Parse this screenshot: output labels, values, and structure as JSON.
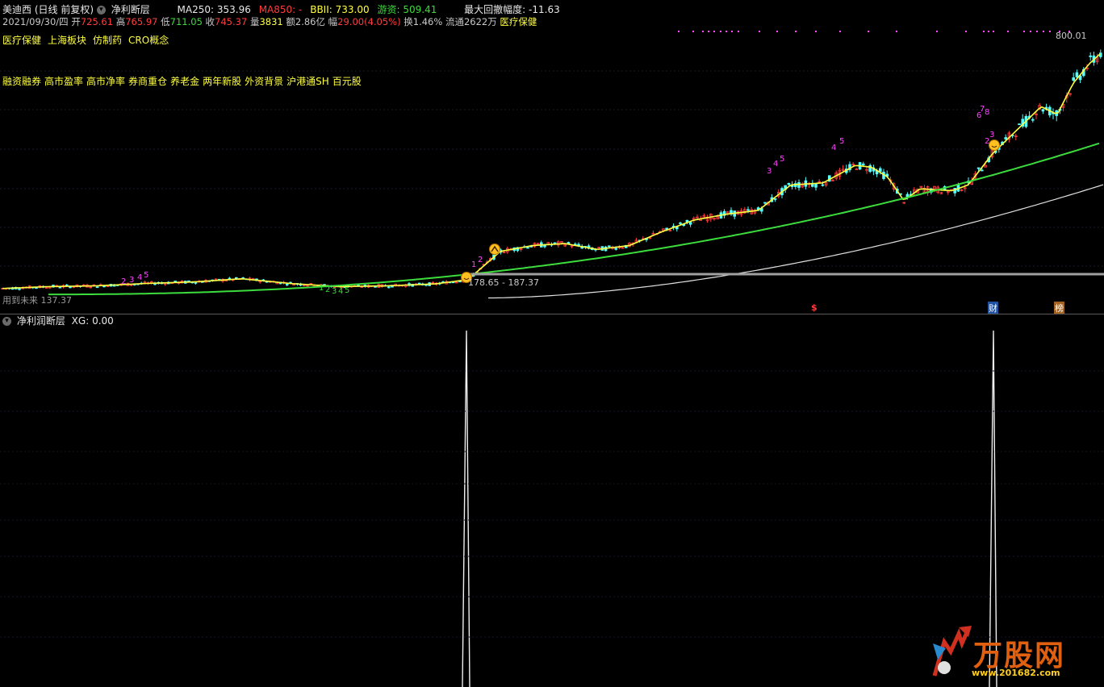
{
  "header": {
    "stock_name": "美迪西",
    "period": "(日线 前复权)",
    "indicator": "净利断层",
    "ma250_label": "MA250:",
    "ma250_value": "353.96",
    "ma850_label": "MA850:",
    "ma850_value": "-",
    "bbii_label": "BBII:",
    "bbii_value": "733.00",
    "youzi_label": "游资:",
    "youzi_value": "509.41",
    "drawdown_label": "最大回撤幅度:",
    "drawdown_value": "-11.63"
  },
  "quote": {
    "date": "2021/09/30/四",
    "open_label": "开",
    "open": "725.61",
    "high_label": "高",
    "high": "765.97",
    "low_label": "低",
    "low": "711.05",
    "close_label": "收",
    "close": "745.37",
    "vol_label": "量",
    "vol": "3831",
    "amount_label": "额",
    "amount": "2.86亿",
    "change_label": "幅",
    "change": "29.00(4.05%)",
    "turnover_label": "换",
    "turnover": "1.46%",
    "float_label": "流通",
    "float": "2622万",
    "sector": "医疗保健"
  },
  "tags_line1": [
    "医疗保健",
    "上海板块",
    "仿制药",
    "CRO概念"
  ],
  "tags_line2": [
    "融资融券",
    "高市盈率",
    "高市净率",
    "券商重仓",
    "养老金",
    "两年新股",
    "外资背景",
    "沪港通SH",
    "百元股"
  ],
  "price_labels": {
    "max_label": "800.01",
    "min_label": "178.65 - 187.37",
    "bottom_left": "用到未来  137.37"
  },
  "event_markers": [
    "$",
    "财",
    "榜"
  ],
  "subchart": {
    "title": "净利润断层",
    "xg_label": "XG:",
    "xg_value": "0.00"
  },
  "watermark": {
    "brand": "万股网",
    "url": "www.201682.com"
  },
  "colors": {
    "up": "#ff3c3c",
    "down": "#54ffff",
    "ma_yellow": "#ffff40",
    "ma_green": "#3cdc3c",
    "ma_white": "#e0e0e0",
    "magenta": "#ff40ff"
  },
  "chart_data": {
    "type": "line",
    "ylim": [
      130,
      810
    ],
    "trend_points": [
      [
        0,
        155
      ],
      [
        60,
        160
      ],
      [
        120,
        162
      ],
      [
        180,
        168
      ],
      [
        240,
        172
      ],
      [
        300,
        180
      ],
      [
        360,
        168
      ],
      [
        420,
        160
      ],
      [
        480,
        162
      ],
      [
        540,
        167
      ],
      [
        580,
        178
      ],
      [
        620,
        250
      ],
      [
        660,
        265
      ],
      [
        700,
        270
      ],
      [
        740,
        255
      ],
      [
        780,
        265
      ],
      [
        820,
        300
      ],
      [
        860,
        330
      ],
      [
        900,
        345
      ],
      [
        940,
        355
      ],
      [
        980,
        420
      ],
      [
        1020,
        425
      ],
      [
        1060,
        470
      ],
      [
        1080,
        465
      ],
      [
        1100,
        440
      ],
      [
        1120,
        380
      ],
      [
        1140,
        410
      ],
      [
        1180,
        405
      ],
      [
        1200,
        420
      ],
      [
        1230,
        500
      ],
      [
        1260,
        560
      ],
      [
        1290,
        620
      ],
      [
        1310,
        600
      ],
      [
        1330,
        680
      ],
      [
        1350,
        730
      ],
      [
        1366,
        760
      ]
    ],
    "signal_series": {
      "name": "XG",
      "spike_x": [
        578,
        1231
      ],
      "ylim": [
        0,
        1
      ]
    }
  }
}
